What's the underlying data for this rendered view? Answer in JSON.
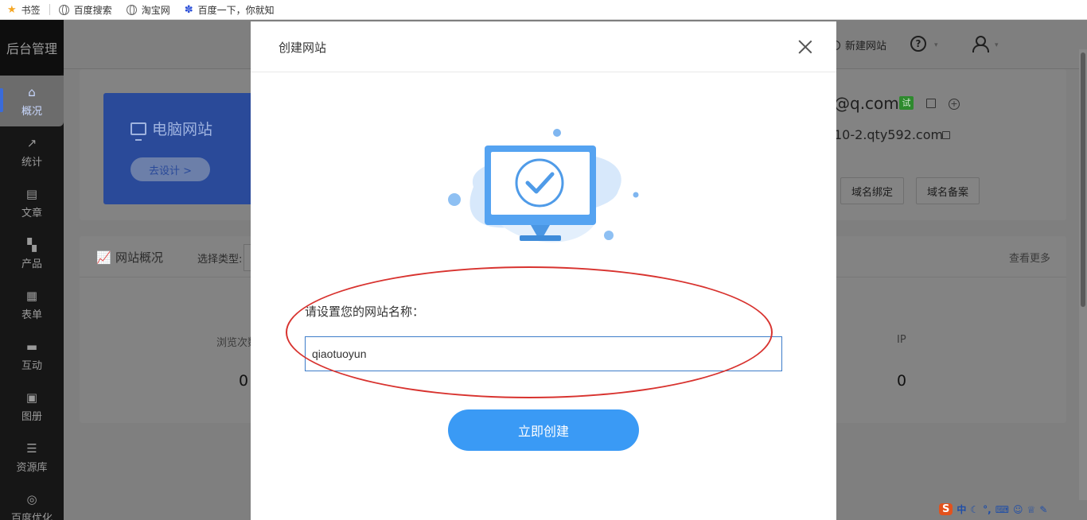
{
  "bookmarks": [
    {
      "label": "书签",
      "icon": "star-icon"
    },
    {
      "label": "百度搜索",
      "icon": "globe-icon"
    },
    {
      "label": "淘宝网",
      "icon": "globe-icon"
    },
    {
      "label": "百度一下，你就知",
      "icon": "baidu-paw-icon"
    }
  ],
  "sidebar": {
    "brand": "后台管理",
    "items": [
      {
        "label": "概况",
        "icon": "home-icon"
      },
      {
        "label": "统计",
        "icon": "stats-icon"
      },
      {
        "label": "文章",
        "icon": "article-icon"
      },
      {
        "label": "产品",
        "icon": "product-icon"
      },
      {
        "label": "表单",
        "icon": "form-icon"
      },
      {
        "label": "互动",
        "icon": "chat-icon"
      },
      {
        "label": "图册",
        "icon": "album-icon"
      },
      {
        "label": "资源库",
        "icon": "database-icon"
      },
      {
        "label": "百度优化",
        "icon": "seo-icon"
      }
    ]
  },
  "topbar": {
    "new_site": "新建网站"
  },
  "site": {
    "pc_title": "电脑网站",
    "design_button": "去设计 >",
    "email": "@q.com",
    "trial_badge": "试",
    "domain": "10-2.qty592.com",
    "bind_domain": "域名绑定",
    "record_domain": "域名备案"
  },
  "overview": {
    "title": "网站概况",
    "select_type": "选择类型:",
    "more": "查看更多",
    "stat_left_label": "浏览次数",
    "stat_left_value": "0",
    "stat_right_label": "IP",
    "stat_right_value": "0"
  },
  "ime": {
    "logo": "S",
    "lang": "中"
  },
  "modal": {
    "title": "创建网站",
    "name_label": "请设置您的网站名称：",
    "name_value": "qiaotuoyun",
    "create_button": "立即创建"
  },
  "colors": {
    "primary": "#3a9af5",
    "annotation": "#d8332f",
    "sidebar": "#161616"
  }
}
